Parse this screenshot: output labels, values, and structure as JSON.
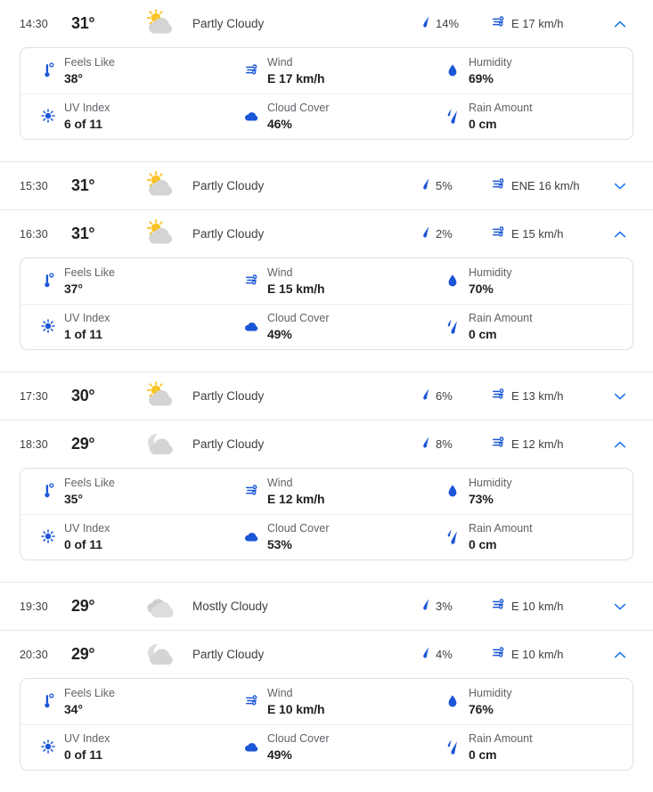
{
  "colors": {
    "accent_blue": "#1a56d6",
    "chevron_blue": "#1a73e8",
    "sun_yellow": "#f9c528",
    "cloud_gray": "#d4d4d4",
    "text_primary": "#202124",
    "text_secondary": "#5f6368",
    "separator": "#e4e4e4",
    "card_border": "#e0e0e0"
  },
  "detail_labels": {
    "feels_like": "Feels Like",
    "wind": "Wind",
    "humidity": "Humidity",
    "uv_index": "UV Index",
    "cloud_cover": "Cloud Cover",
    "rain_amount": "Rain Amount"
  },
  "icon_names": {
    "feels_like": "thermometer-icon",
    "wind": "wind-icon",
    "humidity": "water-drop-icon",
    "uv_index": "sun-uv-icon",
    "cloud_cover": "cloud-icon",
    "rain_amount": "raindrops-icon",
    "precip_chance": "raindrop-icon",
    "expand": "chevron-down-icon",
    "collapse": "chevron-up-icon",
    "partly_cloudy_day": "partly-cloudy-day-icon",
    "partly_cloudy_night": "partly-cloudy-night-icon",
    "mostly_cloudy": "mostly-cloudy-icon"
  },
  "hours": [
    {
      "time": "14:30",
      "temp": "31°",
      "condition": "Partly Cloudy",
      "condition_icon": "partly-cloudy-day-icon",
      "precip_chance": "14%",
      "wind_summary": "E 17 km/h",
      "expanded": true,
      "separator_above": false,
      "details": {
        "feels_like": "38°",
        "wind": "E 17 km/h",
        "humidity": "69%",
        "uv_index": "6 of 11",
        "cloud_cover": "46%",
        "rain_amount": "0 cm"
      }
    },
    {
      "time": "15:30",
      "temp": "31°",
      "condition": "Partly Cloudy",
      "condition_icon": "partly-cloudy-day-icon",
      "precip_chance": "5%",
      "wind_summary": "ENE 16 km/h",
      "expanded": false,
      "separator_above": true,
      "details": null
    },
    {
      "time": "16:30",
      "temp": "31°",
      "condition": "Partly Cloudy",
      "condition_icon": "partly-cloudy-day-icon",
      "precip_chance": "2%",
      "wind_summary": "E 15 km/h",
      "expanded": true,
      "separator_above": true,
      "details": {
        "feels_like": "37°",
        "wind": "E 15 km/h",
        "humidity": "70%",
        "uv_index": "1 of 11",
        "cloud_cover": "49%",
        "rain_amount": "0 cm"
      }
    },
    {
      "time": "17:30",
      "temp": "30°",
      "condition": "Partly Cloudy",
      "condition_icon": "partly-cloudy-day-icon",
      "precip_chance": "6%",
      "wind_summary": "E 13 km/h",
      "expanded": false,
      "separator_above": true,
      "details": null
    },
    {
      "time": "18:30",
      "temp": "29°",
      "condition": "Partly Cloudy",
      "condition_icon": "partly-cloudy-night-icon",
      "precip_chance": "8%",
      "wind_summary": "E 12 km/h",
      "expanded": true,
      "separator_above": true,
      "details": {
        "feels_like": "35°",
        "wind": "E 12 km/h",
        "humidity": "73%",
        "uv_index": "0 of 11",
        "cloud_cover": "53%",
        "rain_amount": "0 cm"
      }
    },
    {
      "time": "19:30",
      "temp": "29°",
      "condition": "Mostly Cloudy",
      "condition_icon": "mostly-cloudy-icon",
      "precip_chance": "3%",
      "wind_summary": "E 10 km/h",
      "expanded": false,
      "separator_above": true,
      "details": null
    },
    {
      "time": "20:30",
      "temp": "29°",
      "condition": "Partly Cloudy",
      "condition_icon": "partly-cloudy-night-icon",
      "precip_chance": "4%",
      "wind_summary": "E 10 km/h",
      "expanded": true,
      "separator_above": true,
      "details": {
        "feels_like": "34°",
        "wind": "E 10 km/h",
        "humidity": "76%",
        "uv_index": "0 of 11",
        "cloud_cover": "49%",
        "rain_amount": "0 cm"
      }
    }
  ]
}
